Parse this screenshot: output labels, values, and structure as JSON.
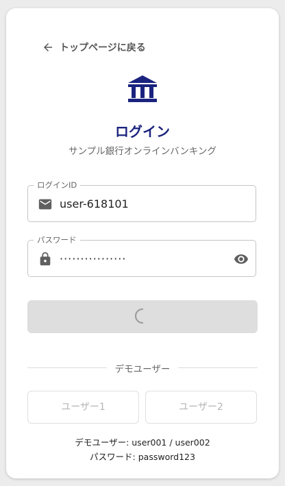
{
  "back_link": {
    "label": "トップページに戻る"
  },
  "header": {
    "title": "ログイン",
    "subtitle": "サンプル銀行オンラインバンキング"
  },
  "login_id": {
    "label": "ログインID",
    "value": "user-618101"
  },
  "password": {
    "label": "パスワード",
    "value": "················"
  },
  "login_button": {
    "state": "loading"
  },
  "divider": {
    "text": "デモユーザー"
  },
  "demo_buttons": [
    {
      "label": "ユーザー1"
    },
    {
      "label": "ユーザー2"
    }
  ],
  "hints": {
    "demo_users": "デモユーザー: user001 / user002",
    "password": "パスワード: password123"
  },
  "colors": {
    "brand": "#1a237e",
    "icon": "#5f5f5f",
    "disabled": "#dedede"
  },
  "icons": {
    "back": "arrow-left-icon",
    "logo": "bank-icon",
    "login_id": "mail-icon",
    "password": "lock-icon",
    "toggle": "eye-icon",
    "loading": "spinner-icon"
  }
}
